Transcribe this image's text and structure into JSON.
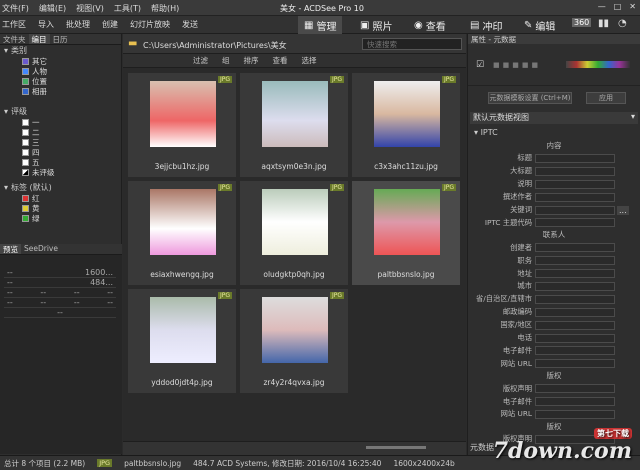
{
  "menu": [
    "文件(F)",
    "编辑(E)",
    "视图(V)",
    "工具(T)",
    "帮助(H)"
  ],
  "window_title": "美女 - ACDSee Pro 10",
  "toolbar": {
    "items": [
      "工作区",
      "导入",
      "批处理",
      "创建",
      "幻灯片放映",
      "发送"
    ]
  },
  "modes": [
    {
      "label": "管理",
      "active": true
    },
    {
      "label": "照片",
      "active": false
    },
    {
      "label": "查看",
      "active": false
    },
    {
      "label": "冲印",
      "active": false
    },
    {
      "label": "编辑",
      "active": false
    }
  ],
  "left_tabs": [
    "文件夹",
    "编目",
    "日历"
  ],
  "categories": {
    "header": "类别",
    "items": [
      "其它",
      "人物",
      "位置",
      "相册"
    ]
  },
  "ratings": {
    "header": "评级",
    "items": [
      "一",
      "二",
      "三",
      "四",
      "五",
      "未评级"
    ]
  },
  "colorlabels": {
    "header": "标签 (默认)",
    "items": [
      "红",
      "黄",
      "绿"
    ]
  },
  "preview": {
    "tabs": [
      "预览",
      "SeeDrive"
    ],
    "vals": [
      "1600...",
      "484..."
    ]
  },
  "path": "C:\\Users\\Administrator\\Pictures\\美女",
  "search_placeholder": "快速搜索",
  "filterbar": [
    "过滤",
    "组",
    "排序",
    "查看",
    "选择"
  ],
  "files": [
    {
      "name": "3ejjcbu1hz.jpg",
      "tag": "JPG",
      "selected": false
    },
    {
      "name": "aqxtsym0e3n.jpg",
      "tag": "JPG",
      "selected": false
    },
    {
      "name": "c3x3ahc11zu.jpg",
      "tag": "JPG",
      "selected": false
    },
    {
      "name": "esiaxhwengq.jpg",
      "tag": "JPG",
      "selected": false
    },
    {
      "name": "oludgktp0qh.jpg",
      "tag": "JPG",
      "selected": false
    },
    {
      "name": "paltbbsnslo.jpg",
      "tag": "JPG",
      "selected": true
    },
    {
      "name": "yddod0jdt4p.jpg",
      "tag": "JPG",
      "selected": false
    },
    {
      "name": "zr4y2r4qvxa.jpg",
      "tag": "JPG",
      "selected": false
    }
  ],
  "right": {
    "title": "属性 - 元数据",
    "template_btn": "元数据模板设置 (Ctrl+M)",
    "apply_btn": "应用",
    "view_select": "默认元数据视图",
    "iptc_header": "IPTC",
    "groups": [
      {
        "title": "内容",
        "fields": [
          "标题",
          "大标题",
          "说明",
          "撰述作者",
          "关键词",
          "IPTC 主题代码"
        ]
      },
      {
        "title": "联系人",
        "fields": [
          "创建者",
          "职务",
          "地址",
          "城市",
          "省/自治区/直辖市",
          "邮政编码",
          "国家/地区",
          "电话",
          "电子邮件",
          "网站 URL"
        ]
      },
      {
        "title": "版权",
        "fields": [
          "版权声明",
          "电子邮件",
          "网站 URL"
        ]
      },
      {
        "title": "版权",
        "fields": [
          "版权声明"
        ]
      }
    ],
    "footer": "元数据"
  },
  "status": {
    "count": "总计 8 个项目 (2.2 MB)",
    "tag": "JPG",
    "file": "paltbbsnslo.jpg",
    "info": "484.7 ACD Systems, 修改日期: 2016/10/4 16:25:40",
    "dims": "1600x2400x24b"
  },
  "watermark": {
    "text": "7down.com",
    "badge": "第七下载"
  }
}
